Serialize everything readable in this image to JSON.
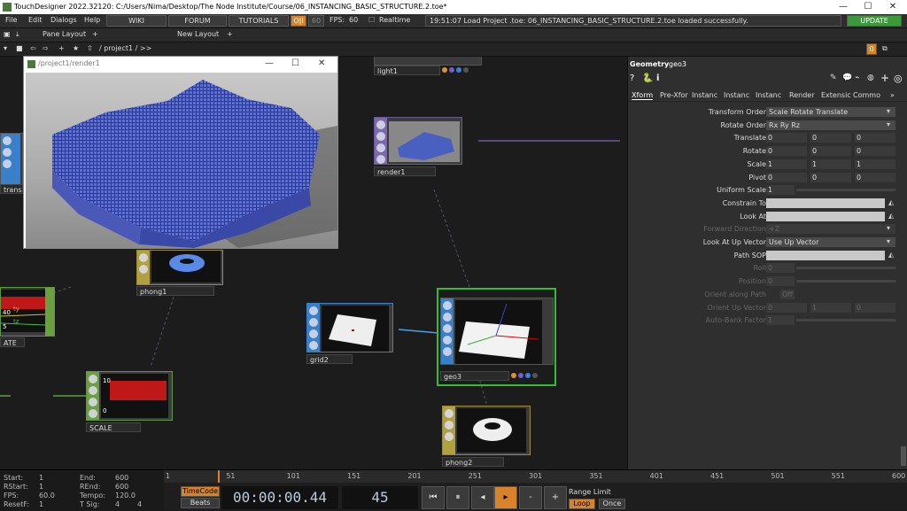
{
  "window": {
    "title": "TouchDesigner 2022.32120: C:/Users/Nima/Desktop/The Node Institute/Course/06_INSTANCING_BASIC_STRUCTURE.2.toe*"
  },
  "menu": {
    "items": [
      "File",
      "Edit",
      "Dialogs",
      "Help"
    ],
    "wiki": "WIKI",
    "forum": "FORUM",
    "tutorials": "TUTORIALS",
    "oi": "O|I",
    "fps_target": "60",
    "fps_label": "FPS:",
    "fps_value": "60",
    "realtime": "Realtime",
    "status": "19:51:07 Load Project .toe: 06_INSTANCING_BASIC_STRUCTURE.2.toe loaded successfully.",
    "update": "UPDATE"
  },
  "toolbar": {
    "pane_layout": "Pane Layout",
    "new_layout": "New Layout",
    "path": "/ project1 / >>",
    "pane_index": "0"
  },
  "render_window": {
    "title": "/project1/render1"
  },
  "nodes": {
    "light1": "light1",
    "render1": "render1",
    "trans": "trans",
    "phong1": "phong1",
    "ate": "ATE",
    "grid2": "grid2",
    "geo3": "geo3",
    "scale": "SCALE",
    "phong2": "phong2"
  },
  "node_thumbs": {
    "scale_label_10": "10",
    "scale_label_0": "0",
    "ty": "ty",
    "tz": "tz",
    "tx_val": "40",
    "ty_val": "5"
  },
  "panel": {
    "type": "Geometry",
    "name": "geo3",
    "tabs": [
      "Xform",
      "Pre-Xfor",
      "Instanc",
      "Instanc",
      "Instanc",
      "Render",
      "Extensic",
      "Commo"
    ],
    "rows": [
      {
        "label": "Transform Order",
        "value": "Scale Rotate Translate",
        "kind": "dropdown"
      },
      {
        "label": "Rotate Order",
        "value": "Rx Ry Rz",
        "kind": "dropdown"
      },
      {
        "label": "Translate",
        "values": [
          "0",
          "0",
          "0"
        ],
        "kind": "xyz"
      },
      {
        "label": "Rotate",
        "values": [
          "0",
          "0",
          "0"
        ],
        "kind": "xyz"
      },
      {
        "label": "Scale",
        "values": [
          "1",
          "1",
          "1"
        ],
        "kind": "xyz"
      },
      {
        "label": "Pivot",
        "values": [
          "0",
          "0",
          "0"
        ],
        "kind": "xyz"
      },
      {
        "label": "Uniform Scale",
        "value": "1",
        "kind": "slider"
      },
      {
        "label": "Constrain To",
        "value": "",
        "kind": "field"
      },
      {
        "label": "Look At",
        "value": "",
        "kind": "field"
      },
      {
        "label": "Forward Direction",
        "value": "+Z",
        "kind": "dropdown-dim"
      },
      {
        "label": "Look At Up Vector",
        "value": "Use Up Vector",
        "kind": "dropdown"
      },
      {
        "label": "Path SOP",
        "value": "",
        "kind": "field"
      },
      {
        "label": "Roll",
        "value": "0",
        "kind": "slider-dim"
      },
      {
        "label": "Position",
        "value": "0",
        "kind": "slider-dim"
      },
      {
        "label": "Orient along Path",
        "value": "Off",
        "kind": "toggle-dim"
      },
      {
        "label": "Orient Up Vector",
        "values": [
          "0",
          "1",
          "0"
        ],
        "kind": "xyz-dim"
      },
      {
        "label": "Auto-Bank Factor",
        "value": "1",
        "kind": "slider-dim"
      }
    ]
  },
  "timeline": {
    "start_label": "Start:",
    "start": "1",
    "end_label": "End:",
    "end": "600",
    "rstart_label": "RStart:",
    "rstart": "1",
    "rend_label": "REnd:",
    "rend": "600",
    "fps_label": "FPS:",
    "fps": "60.0",
    "tempo_label": "Tempo:",
    "tempo": "120.0",
    "resetf_label": "ResetF:",
    "resetf": "1",
    "tsig_label": "T Sig:",
    "tsig_a": "4",
    "tsig_b": "4",
    "timecode_btn": "TimeCode",
    "beats_btn": "Beats",
    "timecode": "00:00:00.44",
    "frame": "45",
    "range_limit": "Range Limit",
    "loop": "Loop",
    "once": "Once",
    "ruler": [
      "1",
      "51",
      "101",
      "151",
      "201",
      "251",
      "301",
      "351",
      "401",
      "451",
      "501",
      "551",
      "600"
    ]
  }
}
